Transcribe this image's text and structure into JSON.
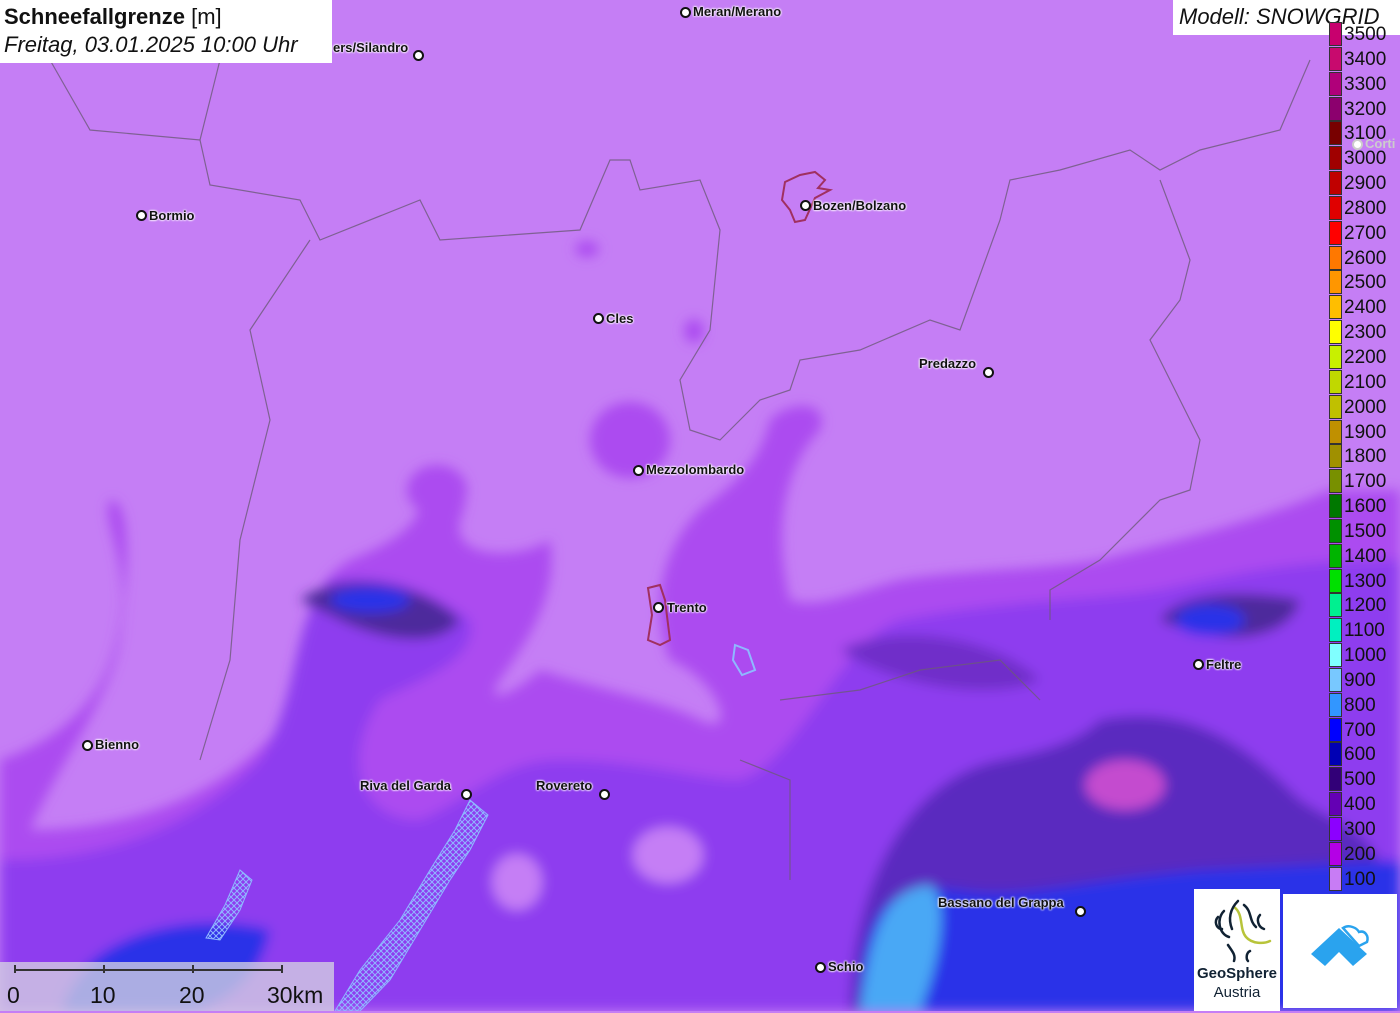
{
  "header": {
    "title_bold": "Schneefallgrenze",
    "title_unit": "[m]",
    "datetime": "Freitag, 03.01.2025 10:00 Uhr"
  },
  "model": {
    "label": "Modell: SNOWGRID"
  },
  "cities": [
    {
      "name": "Meran/Merano"
    },
    {
      "name": "ers/Silandro"
    },
    {
      "name": "Bormio"
    },
    {
      "name": "Bozen/Bolzano"
    },
    {
      "name": "Cles"
    },
    {
      "name": "Predazzo"
    },
    {
      "name": "Mezzolombardo"
    },
    {
      "name": "Trento"
    },
    {
      "name": "Feltre"
    },
    {
      "name": "Bienno"
    },
    {
      "name": "Riva del Garda"
    },
    {
      "name": "Rovereto"
    },
    {
      "name": "Bassano del Grappa"
    },
    {
      "name": "Schio"
    },
    {
      "name": "Corti"
    }
  ],
  "legend": [
    {
      "value": "3500",
      "color": "#c8006e"
    },
    {
      "value": "3400",
      "color": "#c80a6e"
    },
    {
      "value": "3300",
      "color": "#b0007a"
    },
    {
      "value": "3200",
      "color": "#8c006e"
    },
    {
      "value": "3100",
      "color": "#780000"
    },
    {
      "value": "3000",
      "color": "#a00000"
    },
    {
      "value": "2900",
      "color": "#c00000"
    },
    {
      "value": "2800",
      "color": "#e00000"
    },
    {
      "value": "2700",
      "color": "#ff0000"
    },
    {
      "value": "2600",
      "color": "#ff7800"
    },
    {
      "value": "2500",
      "color": "#ff9600"
    },
    {
      "value": "2400",
      "color": "#ffbe00"
    },
    {
      "value": "2300",
      "color": "#ffff00"
    },
    {
      "value": "2200",
      "color": "#c8f000"
    },
    {
      "value": "2100",
      "color": "#c0d800"
    },
    {
      "value": "2000",
      "color": "#c0c000"
    },
    {
      "value": "1900",
      "color": "#c09000"
    },
    {
      "value": "1800",
      "color": "#a09000"
    },
    {
      "value": "1700",
      "color": "#789000"
    },
    {
      "value": "1600",
      "color": "#007800"
    },
    {
      "value": "1500",
      "color": "#009000"
    },
    {
      "value": "1400",
      "color": "#00b400"
    },
    {
      "value": "1300",
      "color": "#00e000"
    },
    {
      "value": "1200",
      "color": "#00f090"
    },
    {
      "value": "1100",
      "color": "#00f0c0"
    },
    {
      "value": "1000",
      "color": "#80ffff"
    },
    {
      "value": "900",
      "color": "#78c8ff"
    },
    {
      "value": "800",
      "color": "#3296ff"
    },
    {
      "value": "700",
      "color": "#0000ff"
    },
    {
      "value": "600",
      "color": "#0000b4"
    },
    {
      "value": "500",
      "color": "#320078"
    },
    {
      "value": "400",
      "color": "#6400b4"
    },
    {
      "value": "300",
      "color": "#8c00ff"
    },
    {
      "value": "200",
      "color": "#b400e6"
    },
    {
      "value": "100",
      "color": "#c87cf5"
    }
  ],
  "scale": {
    "labels": [
      "0",
      "10",
      "20",
      "30km"
    ]
  },
  "logos": {
    "geosphere_line1": "GeoSphere",
    "geosphere_line2": "Austria"
  }
}
